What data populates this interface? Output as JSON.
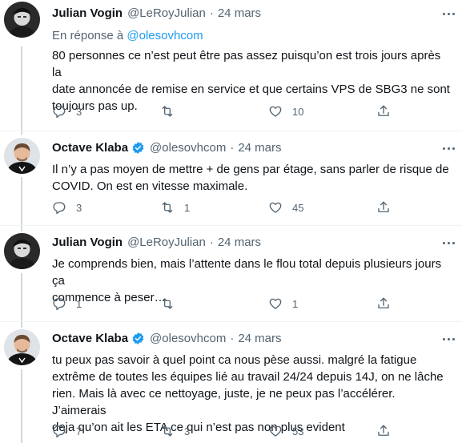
{
  "tweets": [
    {
      "name": "Julian Vogin",
      "handle": "@LeRoyJulian",
      "separator": "·",
      "time": "24 mars",
      "verified": false,
      "avatar": "avatar-julian",
      "reply_prefix": "En réponse à",
      "reply_mention": "@olesovhcom",
      "lines": [
        "80 personnes ce n’est peut être pas assez puisqu’on est trois jours après la",
        "date annoncée de remise en service et que certains VPS de SBG3 ne sont",
        "toujours pas up."
      ],
      "stats": {
        "replies": "3",
        "retweets": "",
        "likes": "10"
      }
    },
    {
      "name": "Octave Klaba",
      "handle": "@olesovhcom",
      "separator": "·",
      "time": "24 mars",
      "verified": true,
      "avatar": "avatar-octave",
      "lines": [
        "Il n’y a pas moyen de mettre + de gens par étage, sans parler de risque de",
        "COVID. On est en vitesse maximale."
      ],
      "stats": {
        "replies": "3",
        "retweets": "1",
        "likes": "45"
      }
    },
    {
      "name": "Julian Vogin",
      "handle": "@LeRoyJulian",
      "separator": "·",
      "time": "24 mars",
      "verified": false,
      "avatar": "avatar-julian",
      "lines": [
        "Je comprends bien, mais l’attente dans le flou total depuis plusieurs jours ça",
        "commence à peser…"
      ],
      "stats": {
        "replies": "1",
        "retweets": "",
        "likes": "1"
      }
    },
    {
      "name": "Octave Klaba",
      "handle": "@olesovhcom",
      "separator": "·",
      "time": "24 mars",
      "verified": true,
      "avatar": "avatar-octave",
      "lines": [
        "tu peux pas savoir à quel point ca nous pèse aussi. malgré la fatigue",
        "extrême de toutes les équipes lié au travail 24/24 depuis 14J, on ne lâche",
        "rien. Mais là avec ce nettoyage, juste, je ne peux pas l’accélérer. J’aimerais",
        "deja qu’on ait les ETA ce qui n’est pas non plus evident"
      ],
      "stats": {
        "replies": "7",
        "retweets": "3",
        "likes": "53"
      }
    }
  ],
  "colors": {
    "accent": "#1d9bf0",
    "secondary_text": "#536471",
    "primary_text": "#0f1419",
    "thread_line": "#cfd9de"
  }
}
